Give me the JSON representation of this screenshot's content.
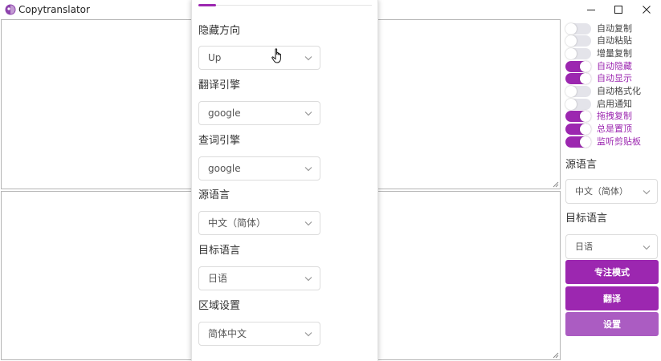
{
  "window": {
    "title": "Copytranslator",
    "controls": {
      "minimize_icon": "minimize-icon",
      "maximize_icon": "maximize-icon",
      "close_icon": "close-icon"
    }
  },
  "settings_panel": {
    "fields": [
      {
        "label": "隐藏方向",
        "value": "Up"
      },
      {
        "label": "翻译引擎",
        "value": "google"
      },
      {
        "label": "查词引擎",
        "value": "google"
      },
      {
        "label": "源语言",
        "value": "中文（简体）"
      },
      {
        "label": "目标语言",
        "value": "日语"
      },
      {
        "label": "区域设置",
        "value": "简体中文"
      }
    ]
  },
  "right_pane": {
    "toggles": [
      {
        "label": "自动复制",
        "on": false
      },
      {
        "label": "自动粘贴",
        "on": false
      },
      {
        "label": "增量复制",
        "on": false
      },
      {
        "label": "自动隐藏",
        "on": true
      },
      {
        "label": "自动显示",
        "on": true
      },
      {
        "label": "自动格式化",
        "on": false
      },
      {
        "label": "启用通知",
        "on": false
      },
      {
        "label": "拖拽复制",
        "on": true
      },
      {
        "label": "总是置顶",
        "on": true
      },
      {
        "label": "监听剪贴板",
        "on": true
      }
    ],
    "source_language": {
      "label": "源语言",
      "value": "中文（简体）"
    },
    "target_language": {
      "label": "目标语言",
      "value": "日语"
    },
    "buttons": {
      "focus_mode": "专注模式",
      "translate": "翻译",
      "settings": "设置"
    }
  },
  "colors": {
    "accent": "#9c27b0",
    "button_dark": "#9c27b0",
    "button_light": "#ab5cc2",
    "toggle_off": "#e4e4ea"
  }
}
